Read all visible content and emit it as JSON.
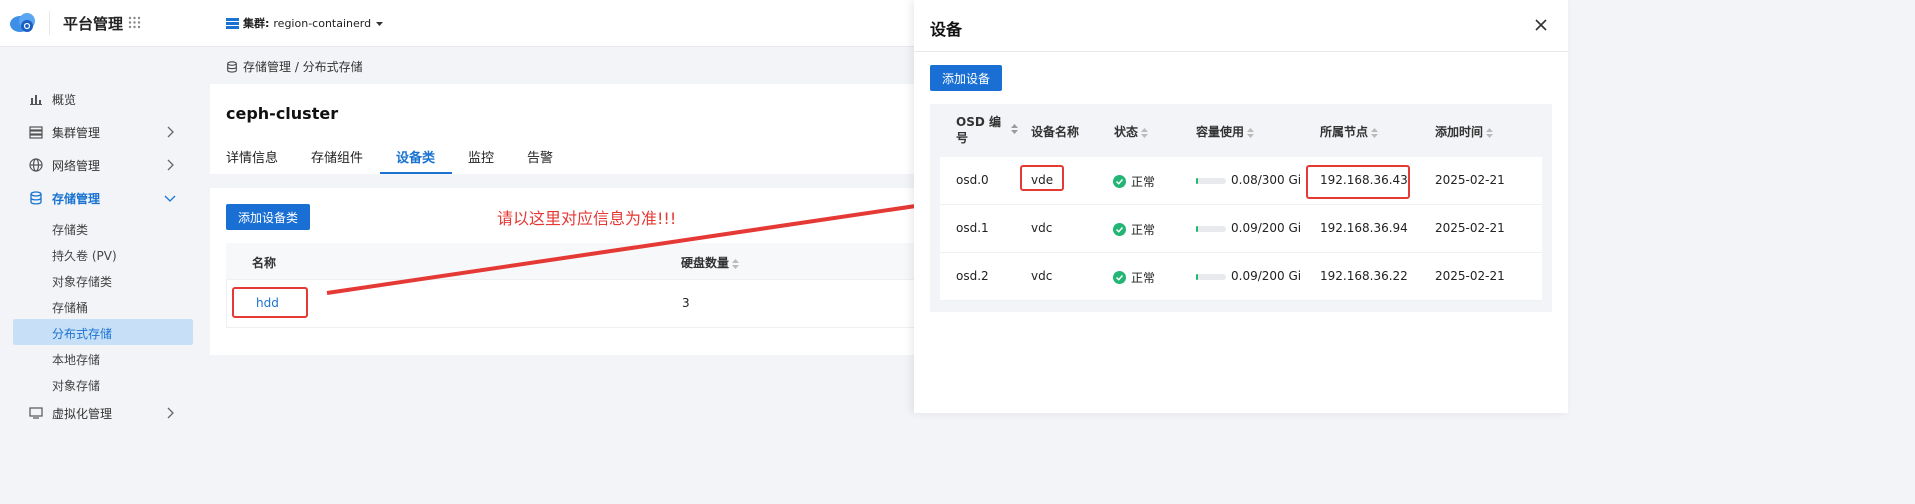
{
  "app": {
    "name": "平台管理"
  },
  "cluster": {
    "label": "集群:",
    "value": "region-containerd"
  },
  "sidebar": {
    "items": [
      {
        "label": "概览",
        "icon": "chart-icon"
      },
      {
        "label": "集群管理",
        "icon": "server-icon"
      },
      {
        "label": "网络管理",
        "icon": "globe-icon"
      },
      {
        "label": "存储管理",
        "icon": "database-icon"
      },
      {
        "label": "虚拟化管理",
        "icon": "vm-icon"
      }
    ],
    "sub_items": [
      "存储类",
      "持久卷 (PV)",
      "对象存储类",
      "存储桶",
      "分布式存储",
      "本地存储",
      "对象存储"
    ]
  },
  "breadcrumb": "存储管理 / 分布式存储",
  "detail": {
    "title": "ceph-cluster",
    "tabs": [
      "详情信息",
      "存储组件",
      "设备类",
      "监控",
      "告警"
    ],
    "add_button": "添加设备类",
    "columns": [
      "名称",
      "硬盘数量"
    ],
    "rows": [
      {
        "name": "hdd",
        "count": "3"
      }
    ]
  },
  "annotation": "请以这里对应信息为准!!!",
  "panel": {
    "title": "设备",
    "add_button": "添加设备",
    "columns": [
      "OSD 编号",
      "设备名称",
      "状态",
      "容量使用",
      "所属节点",
      "添加时间"
    ],
    "rows": [
      {
        "osd": "osd.0",
        "device": "vde",
        "status": "正常",
        "usage_text": "0.08/300 Gi",
        "usage_fraction": 0.0003,
        "node": "192.168.36.43",
        "date": "2025-02-21"
      },
      {
        "osd": "osd.1",
        "device": "vdc",
        "status": "正常",
        "usage_text": "0.09/200 Gi",
        "usage_fraction": 0.0005,
        "node": "192.168.36.94",
        "date": "2025-02-21"
      },
      {
        "osd": "osd.2",
        "device": "vdc",
        "status": "正常",
        "usage_text": "0.09/200 Gi",
        "usage_fraction": 0.0005,
        "node": "192.168.36.22",
        "date": "2025-02-21"
      }
    ]
  },
  "colors": {
    "accent": "#1a73d1",
    "annotation": "#e53935",
    "ok": "#22b573"
  }
}
